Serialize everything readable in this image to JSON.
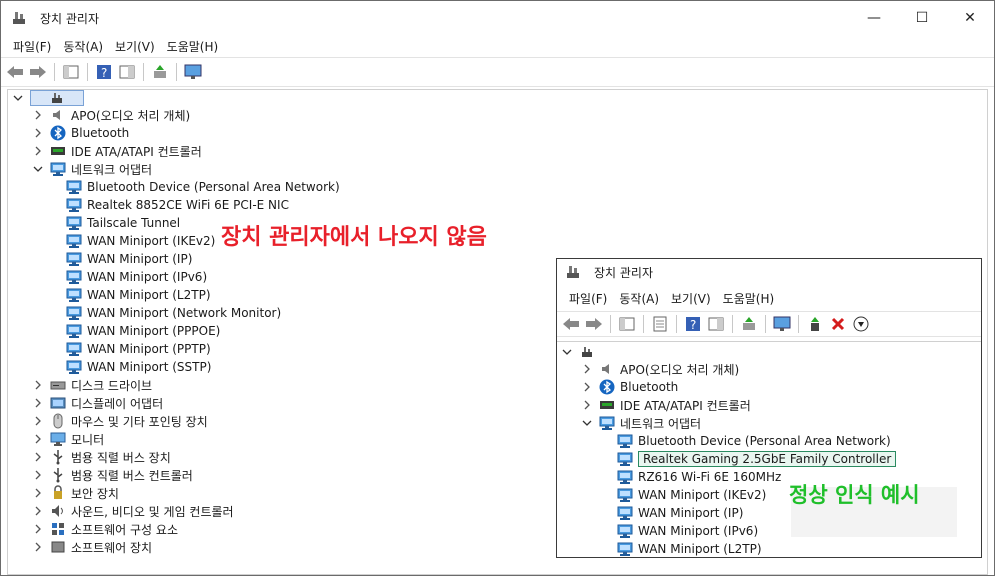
{
  "main": {
    "title": "장치 관리자",
    "controls": {
      "minimize": "—",
      "maximize": "☐",
      "close": "✕"
    },
    "menu": [
      "파일(F)",
      "동작(A)",
      "보기(V)",
      "도움말(H)"
    ],
    "tree": [
      {
        "label": "APO(오디오 처리 개체)",
        "icon": "audio-icon",
        "expanded": false
      },
      {
        "label": "Bluetooth",
        "icon": "bluetooth-icon",
        "expanded": false
      },
      {
        "label": "IDE ATA/ATAPI 컨트롤러",
        "icon": "ide-controller-icon",
        "expanded": false
      },
      {
        "label": "네트워크 어댑터",
        "icon": "network-adapter-icon",
        "expanded": true
      },
      {
        "label": "Bluetooth Device (Personal Area Network)",
        "icon": "network-adapter-icon",
        "child": true
      },
      {
        "label": "Realtek 8852CE WiFi 6E PCI-E NIC",
        "icon": "network-adapter-icon",
        "child": true
      },
      {
        "label": "Tailscale Tunnel",
        "icon": "network-adapter-icon",
        "child": true
      },
      {
        "label": "WAN Miniport (IKEv2)",
        "icon": "network-adapter-icon",
        "child": true
      },
      {
        "label": "WAN Miniport (IP)",
        "icon": "network-adapter-icon",
        "child": true
      },
      {
        "label": "WAN Miniport (IPv6)",
        "icon": "network-adapter-icon",
        "child": true
      },
      {
        "label": "WAN Miniport (L2TP)",
        "icon": "network-adapter-icon",
        "child": true
      },
      {
        "label": "WAN Miniport (Network Monitor)",
        "icon": "network-adapter-icon",
        "child": true
      },
      {
        "label": "WAN Miniport (PPPOE)",
        "icon": "network-adapter-icon",
        "child": true
      },
      {
        "label": "WAN Miniport (PPTP)",
        "icon": "network-adapter-icon",
        "child": true
      },
      {
        "label": "WAN Miniport (SSTP)",
        "icon": "network-adapter-icon",
        "child": true
      },
      {
        "label": "디스크 드라이브",
        "icon": "disk-drive-icon",
        "expanded": false
      },
      {
        "label": "디스플레이 어댑터",
        "icon": "display-adapter-icon",
        "expanded": false
      },
      {
        "label": "마우스 및 기타 포인팅 장치",
        "icon": "mouse-icon",
        "expanded": false
      },
      {
        "label": "모니터",
        "icon": "monitor-icon",
        "expanded": false
      },
      {
        "label": "범용 직렬 버스 장치",
        "icon": "usb-icon",
        "expanded": false
      },
      {
        "label": "범용 직렬 버스 컨트롤러",
        "icon": "usb-icon",
        "expanded": false
      },
      {
        "label": "보안 장치",
        "icon": "security-device-icon",
        "expanded": false
      },
      {
        "label": "사운드, 비디오 및 게임 컨트롤러",
        "icon": "sound-icon",
        "expanded": false
      },
      {
        "label": "소프트웨어 구성 요소",
        "icon": "software-component-icon",
        "expanded": false
      },
      {
        "label": "소프트웨어 장치",
        "icon": "software-device-icon",
        "expanded": false
      }
    ]
  },
  "annotation_missing": "장치 관리자에서 나오지 않음",
  "annotation_ok": "정상 인식 예시",
  "annotation_colors": {
    "missing": "#e8202a",
    "ok": "#1fbf2a"
  },
  "example": {
    "title": "장치 관리자",
    "menu": [
      "파일(F)",
      "동작(A)",
      "보기(V)",
      "도움말(H)"
    ],
    "tree": [
      {
        "label": "APO(오디오 처리 개체)",
        "icon": "audio-icon",
        "expanded": false
      },
      {
        "label": "Bluetooth",
        "icon": "bluetooth-icon",
        "expanded": false
      },
      {
        "label": "IDE ATA/ATAPI 컨트롤러",
        "icon": "ide-controller-icon",
        "expanded": false
      },
      {
        "label": "네트워크 어댑터",
        "icon": "network-adapter-icon",
        "expanded": true
      },
      {
        "label": "Bluetooth Device (Personal Area Network)",
        "icon": "network-adapter-icon",
        "child": true
      },
      {
        "label": "Realtek Gaming 2.5GbE Family Controller",
        "icon": "network-adapter-icon",
        "child": true,
        "selected": true
      },
      {
        "label": "RZ616 Wi-Fi 6E 160MHz",
        "icon": "network-adapter-icon",
        "child": true
      },
      {
        "label": "WAN Miniport (IKEv2)",
        "icon": "network-adapter-icon",
        "child": true
      },
      {
        "label": "WAN Miniport (IP)",
        "icon": "network-adapter-icon",
        "child": true
      },
      {
        "label": "WAN Miniport (IPv6)",
        "icon": "network-adapter-icon",
        "child": true
      },
      {
        "label": "WAN Miniport (L2TP)",
        "icon": "network-adapter-icon",
        "child": true
      }
    ]
  }
}
